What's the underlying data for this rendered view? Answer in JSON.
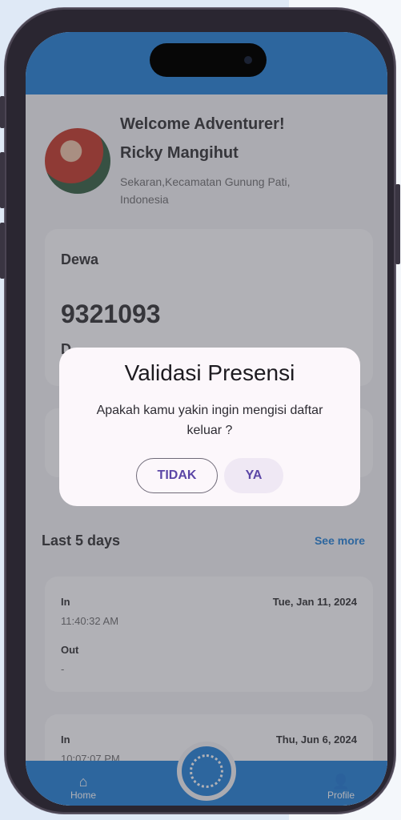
{
  "profile": {
    "welcome": "Welcome Adventurer!",
    "name": "Ricky Mangihut",
    "address": "Sekaran,Kecamatan Gunung Pati, Indonesia"
  },
  "card": {
    "title": "Dewa",
    "id_number": "9321093",
    "partial_text": "D"
  },
  "attendance": {
    "section_title": "Last 5 days",
    "see_more": "See more",
    "records": [
      {
        "in_label": "In",
        "in_time": "11:40:32 AM",
        "date": "Tue, Jan 11, 2024",
        "out_label": "Out",
        "out_time": "-"
      },
      {
        "in_label": "In",
        "in_time": "10:07:07 PM",
        "date": "Thu, Jun 6, 2024"
      }
    ]
  },
  "nav": {
    "home": "Home",
    "profile": "Profile",
    "home_icon": "home-icon",
    "profile_icon": "person-icon",
    "center_icon": "fingerprint-icon"
  },
  "dialog": {
    "title": "Validasi Presensi",
    "message": "Apakah kamu yakin ingin mengisi daftar keluar ?",
    "cancel_label": "TIDAK",
    "confirm_label": "YA"
  },
  "colors": {
    "primary": "#1c7fd6",
    "dialog_bg": "#fcf7fb",
    "button_text": "#5b46a6"
  }
}
